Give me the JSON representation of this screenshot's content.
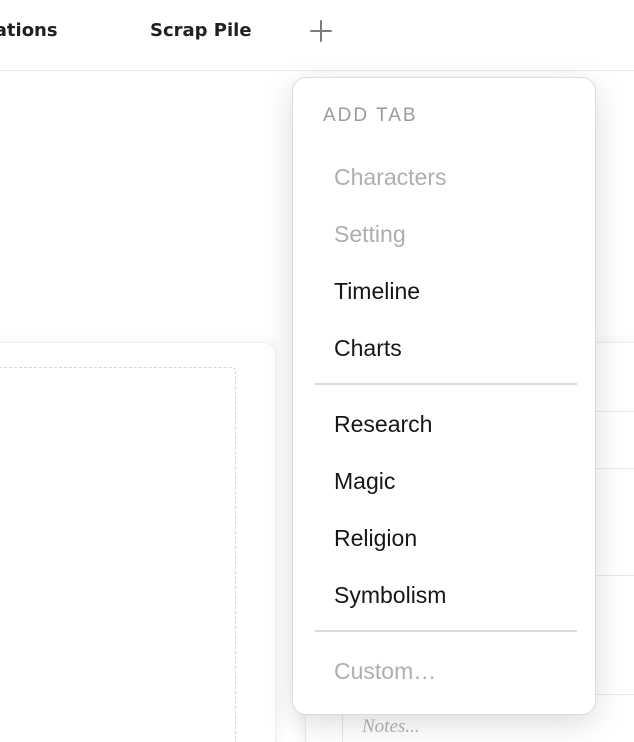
{
  "tabs": [
    {
      "label": "itations"
    },
    {
      "label": "Scrap Pile"
    }
  ],
  "add_tab_icon": "plus-icon",
  "side_panel": {
    "notes_placeholder": "Notes..."
  },
  "menu": {
    "header": "ADD TAB",
    "group_core": [
      {
        "label": "Characters",
        "enabled": false
      },
      {
        "label": "Setting",
        "enabled": false
      },
      {
        "label": "Timeline",
        "enabled": true
      },
      {
        "label": "Charts",
        "enabled": true
      }
    ],
    "group_extra": [
      {
        "label": "Research",
        "enabled": true
      },
      {
        "label": "Magic",
        "enabled": true
      },
      {
        "label": "Religion",
        "enabled": true
      },
      {
        "label": "Symbolism",
        "enabled": true
      }
    ],
    "custom": {
      "label": "Custom…",
      "enabled": false
    }
  },
  "colors": {
    "text_primary": "#16161a",
    "text_disabled": "#aeaeb2",
    "header_muted": "#9a9aa0"
  }
}
